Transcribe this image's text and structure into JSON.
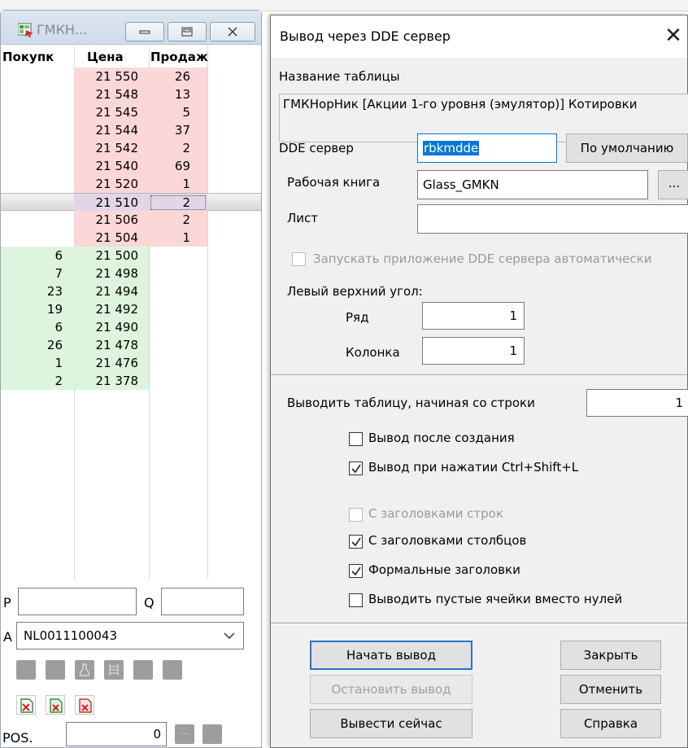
{
  "glass": {
    "title": "ГМКН...",
    "headers": {
      "buy": "Покупк",
      "price": "Цена",
      "sell": "Продаж"
    },
    "asks": [
      {
        "price": "21 550",
        "sell": "26"
      },
      {
        "price": "21 548",
        "sell": "13"
      },
      {
        "price": "21 545",
        "sell": "5"
      },
      {
        "price": "21 544",
        "sell": "37"
      },
      {
        "price": "21 542",
        "sell": "2"
      },
      {
        "price": "21 540",
        "sell": "69"
      },
      {
        "price": "21 520",
        "sell": "1"
      }
    ],
    "mid": {
      "price": "21 510",
      "sell": "2"
    },
    "asks_below": [
      {
        "price": "21 506",
        "sell": "2"
      },
      {
        "price": "21 504",
        "sell": "1"
      }
    ],
    "bids": [
      {
        "buy": "6",
        "price": "21 500"
      },
      {
        "buy": "7",
        "price": "21 498"
      },
      {
        "buy": "23",
        "price": "21 494"
      },
      {
        "buy": "19",
        "price": "21 492"
      },
      {
        "buy": "6",
        "price": "21 490"
      },
      {
        "buy": "26",
        "price": "21 478"
      },
      {
        "buy": "1",
        "price": "21 476"
      },
      {
        "buy": "2",
        "price": "21 378"
      }
    ],
    "p_label": "P",
    "q_label": "Q",
    "a_label": "A",
    "account": "NL0011100043",
    "pos_label": "POS.",
    "pos_value": "0",
    "pos_btn1": "...",
    "colors": {
      "ask": "#fbd7d7",
      "bid": "#ddf5dd",
      "mid": "#e2d6e6"
    }
  },
  "dialog": {
    "title": "Вывод через DDE сервер",
    "close_glyph": "✕",
    "table_name_label": "Название таблицы",
    "table_name": "ГМКНорНик [Акции 1-го уровня (эмулятор)] Котировки",
    "dde_server_label": "DDE сервер",
    "dde_server": "rbkmdde",
    "default_button": "По умолчанию",
    "workbook_label": "Рабочая книга",
    "workbook": "Glass_GMKN",
    "browse_button": "...",
    "sheet_label": "Лист",
    "sheet": "",
    "autostart_label": "Запускать приложение DDE сервера автоматически",
    "top_left_label": "Левый верхний угол:",
    "row_label": "Ряд",
    "row_value": "1",
    "column_label": "Колонка",
    "column_value": "1",
    "start_row_label": "Выводить таблицу,  начиная со строки",
    "start_row_value": "1",
    "options": [
      {
        "label": "Вывод после создания",
        "checked": false,
        "enabled": true
      },
      {
        "label": "Вывод при нажатии Ctrl+Shift+L",
        "checked": true,
        "enabled": true
      },
      {
        "label": "С заголовками строк",
        "checked": false,
        "enabled": false
      },
      {
        "label": "С заголовками столбцов",
        "checked": true,
        "enabled": true
      },
      {
        "label": "Формальные заголовки",
        "checked": true,
        "enabled": true
      },
      {
        "label": "Выводить пустые ячейки вместо нулей",
        "checked": false,
        "enabled": true
      }
    ],
    "buttons": {
      "start": "Начать вывод",
      "stop": "Остановить вывод",
      "now": "Вывести сейчас",
      "close": "Закрыть",
      "cancel": "Отменить",
      "help": "Справка"
    },
    "accent": "#0078d7"
  }
}
